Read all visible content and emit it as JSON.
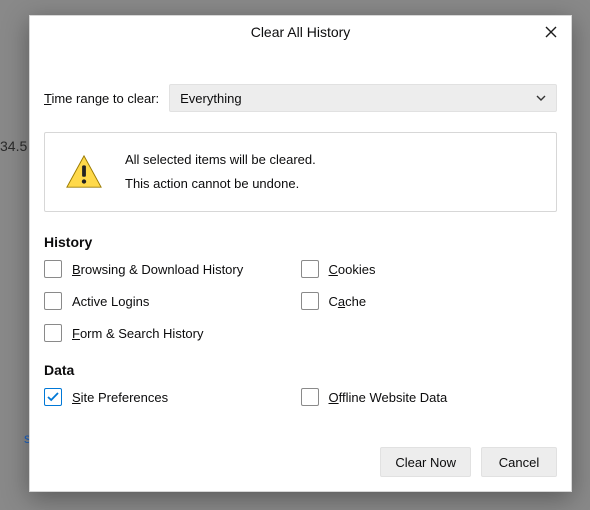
{
  "bg": {
    "fragment1": "34.5",
    "fragment2": "s"
  },
  "dialog": {
    "title": "Clear All History",
    "range_label_pre": "T",
    "range_label_rest": "ime range to clear:",
    "select_value": "Everything",
    "alert_line1": "All selected items will be cleared.",
    "alert_line2": "This action cannot be undone.",
    "section_history": "History",
    "section_data": "Data",
    "checks": {
      "browsing": {
        "pre": "B",
        "rest": "rowsing & Download History",
        "checked": false
      },
      "cookies": {
        "pre": "C",
        "rest": "ookies",
        "checked": false
      },
      "logins": {
        "pre": "",
        "rest": "Active Logins",
        "checked": false
      },
      "cache": {
        "pre": "",
        "rest": "Cache",
        "checked": false,
        "u_idx": 1
      },
      "forms": {
        "pre": "F",
        "rest": "orm & Search History",
        "checked": false
      },
      "siteprefs": {
        "pre": "S",
        "rest": "ite Preferences",
        "checked": true
      },
      "offline": {
        "pre": "O",
        "rest": "ffline Website Data",
        "checked": false
      }
    },
    "btn_clear": "Clear Now",
    "btn_cancel": "Cancel"
  }
}
